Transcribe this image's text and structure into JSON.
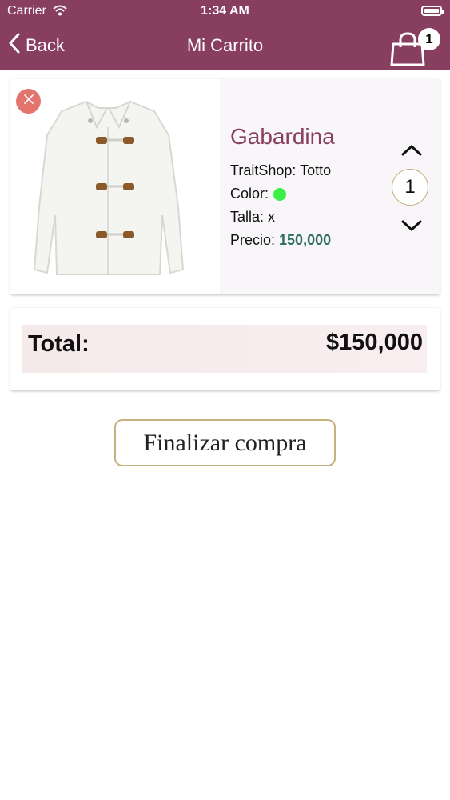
{
  "status_bar": {
    "carrier": "Carrier",
    "time": "1:34 AM"
  },
  "nav": {
    "back_label": "Back",
    "title": "Mi Carrito",
    "cart_count": "1"
  },
  "cart_items": [
    {
      "name": "Gabardina",
      "store_label": "TraitShop:",
      "store": "Totto",
      "color_label": "Color:",
      "color_hex": "#3af046",
      "size_label": "Talla:",
      "size": "x",
      "price_label": "Precio:",
      "price": "150,000",
      "quantity": "1"
    }
  ],
  "summary": {
    "total_label": "Total:",
    "total_value": "$150,000"
  },
  "actions": {
    "checkout_label": "Finalizar compra"
  },
  "colors": {
    "brand": "#883e5e",
    "accent_border": "#c9b07f",
    "remove": "#e3756e",
    "price": "#2e6e60"
  },
  "icons": [
    "wifi-icon",
    "battery-icon",
    "chevron-left-icon",
    "shopping-bag-icon",
    "close-icon",
    "chevron-up-icon",
    "chevron-down-icon"
  ]
}
